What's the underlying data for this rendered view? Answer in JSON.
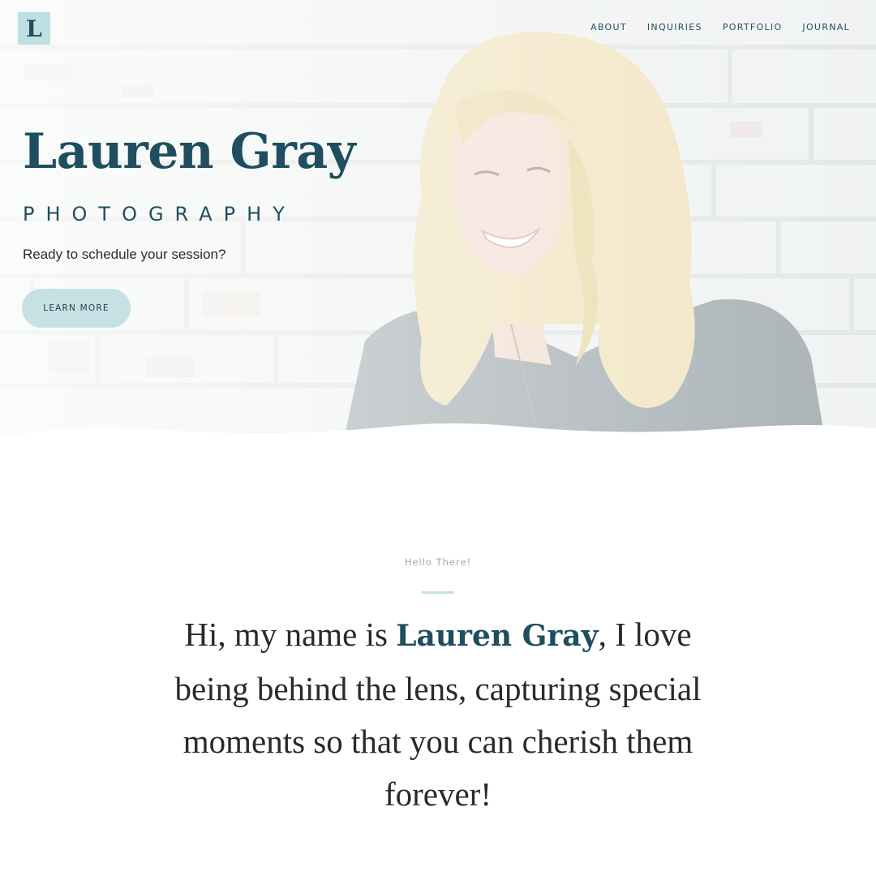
{
  "logo": {
    "letter": "L"
  },
  "nav": {
    "items": [
      "ABOUT",
      "INQUIRIES",
      "PORTFOLIO",
      "JOURNAL"
    ]
  },
  "hero": {
    "title": "Lauren Gray",
    "subtitle": "PHOTOGRAPHY",
    "tagline": "Ready to schedule your session?",
    "cta_label": "LEARN MORE"
  },
  "intro": {
    "eyebrow": "Hello There!",
    "text_before": "Hi, my name is ",
    "name": "Lauren Gray",
    "text_after": ", I love being behind the lens, capturing special moments so that you can cherish them forever!"
  },
  "colors": {
    "brand": "#1f4e5f",
    "accent": "#c6e1e4",
    "muted": "#a7a7a7"
  }
}
